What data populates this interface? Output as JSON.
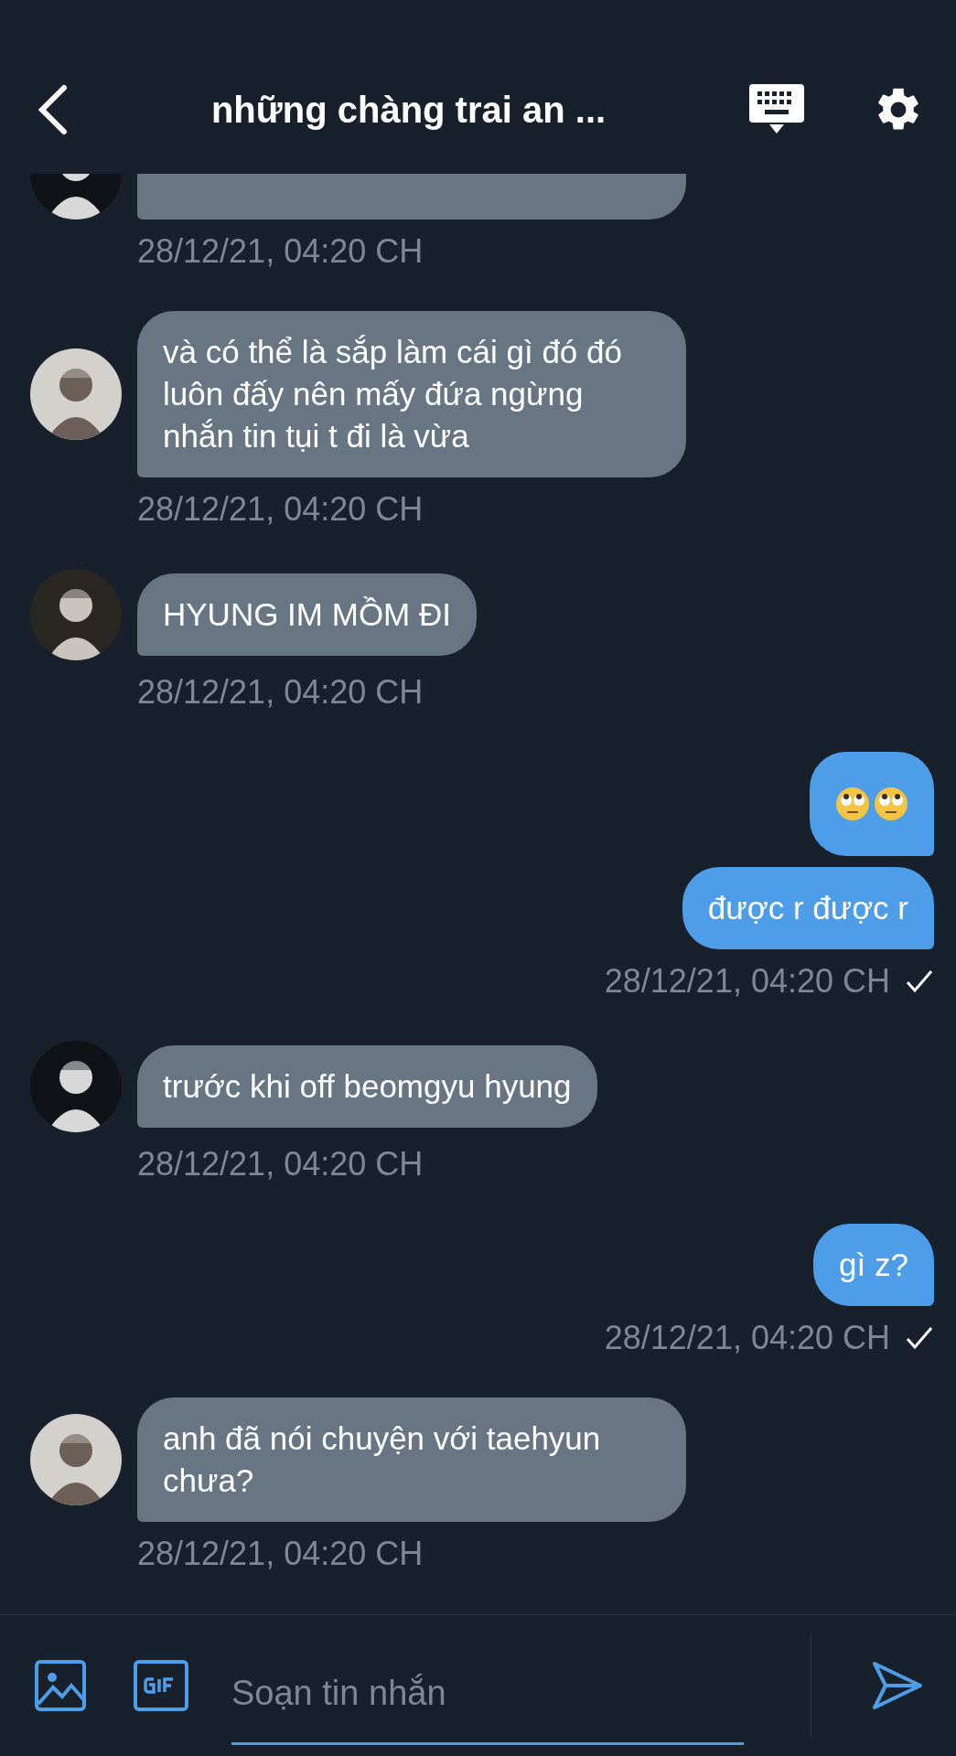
{
  "header": {
    "title": "những chàng trai an ..."
  },
  "messages": [
    {
      "kind": "received_cut",
      "time": "28/12/21, 04:20 CH"
    },
    {
      "kind": "received",
      "text": "và có thể là sắp làm cái gì đó đó luôn đấy nên mấy đứa ngừng nhắn tin tụi t đi là vừa",
      "time": "28/12/21, 04:20 CH"
    },
    {
      "kind": "received",
      "text": "HYUNG IM MỒM ĐI",
      "time": "28/12/21, 04:20 CH"
    },
    {
      "kind": "sent_emoji"
    },
    {
      "kind": "sent",
      "text": "được r được r",
      "time": "28/12/21, 04:20 CH",
      "read": true
    },
    {
      "kind": "received",
      "text": "trước khi off beomgyu hyung",
      "time": "28/12/21, 04:20 CH"
    },
    {
      "kind": "sent",
      "text": "gì z?",
      "time": "28/12/21, 04:20 CH",
      "read": true
    },
    {
      "kind": "received",
      "text": "anh đã nói chuyện với taehyun chưa?",
      "time": "28/12/21, 04:20 CH"
    }
  ],
  "composer": {
    "placeholder": "Soạn tin nhắn"
  }
}
